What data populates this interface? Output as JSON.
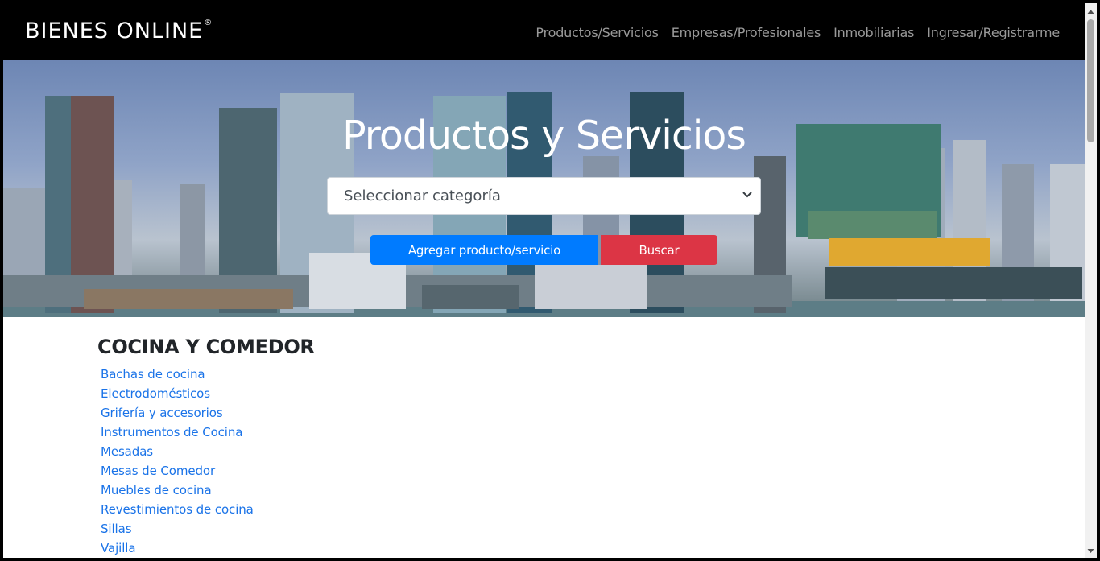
{
  "brand": {
    "name": "BIENES ONLINE",
    "trademark": "®"
  },
  "nav": {
    "items": [
      {
        "label": "Productos/Servicios"
      },
      {
        "label": "Empresas/Profesionales"
      },
      {
        "label": "Inmobiliarias"
      },
      {
        "label": "Ingresar/Registrarme"
      }
    ]
  },
  "hero": {
    "title": "Productos y Servicios",
    "select": {
      "value": "Seleccionar categoría"
    },
    "add_button": "Agregar producto/servicio",
    "search_button": "Buscar"
  },
  "section": {
    "title": "COCINA Y COMEDOR",
    "items": [
      "Bachas de cocina",
      "Electrodomésticos",
      "Grifería y accesorios",
      "Instrumentos de Cocina",
      "Mesadas",
      "Mesas de Comedor",
      "Muebles de cocina",
      "Revestimientos de cocina",
      "Sillas",
      "Vajilla"
    ]
  },
  "colors": {
    "navbar": "#000000",
    "primary_button": "#007bff",
    "danger_button": "#dc3545",
    "link": "#1a73e8"
  },
  "icons": {
    "select": "chevron-down-icon",
    "scroll_up": "arrow-up-icon",
    "scroll_down": "arrow-down-icon"
  }
}
